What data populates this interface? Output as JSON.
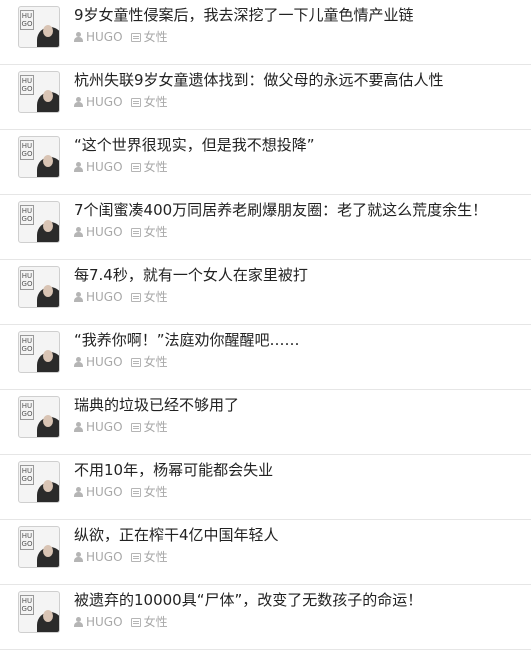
{
  "articles": [
    {
      "title": "9岁女童性侵案后，我去深挖了一下儿童色情产业链",
      "author": "HUGO",
      "category": "女性"
    },
    {
      "title": "杭州失联9岁女童遗体找到：做父母的永远不要高估人性",
      "author": "HUGO",
      "category": "女性"
    },
    {
      "title": "“这个世界很现实，但是我不想投降”",
      "author": "HUGO",
      "category": "女性"
    },
    {
      "title": "7个闺蜜凑400万同居养老刷爆朋友圈：老了就这么荒度余生！",
      "author": "HUGO",
      "category": "女性"
    },
    {
      "title": "每7.4秒，就有一个女人在家里被打",
      "author": "HUGO",
      "category": "女性"
    },
    {
      "title": "“我养你啊！”法庭劝你醒醒吧……",
      "author": "HUGO",
      "category": "女性"
    },
    {
      "title": "瑞典的垃圾已经不够用了",
      "author": "HUGO",
      "category": "女性"
    },
    {
      "title": "不用10年，杨幂可能都会失业",
      "author": "HUGO",
      "category": "女性"
    },
    {
      "title": "纵欲，正在榨干4亿中国年轻人",
      "author": "HUGO",
      "category": "女性"
    },
    {
      "title": "被遗弃的10000具“尸体”，改变了无数孩子的命运！",
      "author": "HUGO",
      "category": "女性"
    }
  ],
  "avatar_logo_text": "HUGO",
  "icons": {
    "author": "user-icon",
    "category": "list-icon"
  },
  "colors": {
    "title": "#222222",
    "meta": "#a8a8a8",
    "divider": "#e6e6e6"
  }
}
